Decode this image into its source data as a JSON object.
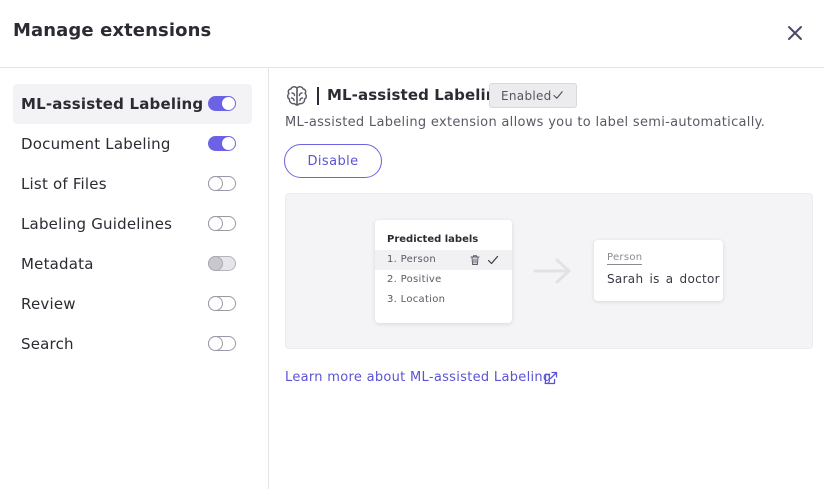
{
  "header": {
    "title": "Manage extensions",
    "close_icon": "close-icon"
  },
  "sidebar": {
    "items": [
      {
        "label": "ML-assisted Labeling",
        "enabled": true,
        "active": true
      },
      {
        "label": "Document Labeling",
        "enabled": true,
        "active": false
      },
      {
        "label": "List of Files",
        "enabled": false,
        "active": false
      },
      {
        "label": "Labeling Guidelines",
        "enabled": false,
        "active": false
      },
      {
        "label": "Metadata",
        "enabled": false,
        "active": false,
        "disabled": true
      },
      {
        "label": "Review",
        "enabled": false,
        "active": false
      },
      {
        "label": "Search",
        "enabled": false,
        "active": false
      }
    ]
  },
  "main": {
    "icon": "brain-icon",
    "title": "ML-assisted Labeling",
    "badge": "Enabled",
    "description": "ML-assisted Labeling extension allows you to label semi-automatically.",
    "disable_label": "Disable",
    "preview": {
      "predicted_title": "Predicted labels",
      "predictions": [
        "1.  Person",
        "2.  Positive",
        "3.  Location"
      ],
      "result_label": "Person",
      "result_text": "Sarah is a doctor"
    },
    "learn_more": "Learn more about ML-assisted Labeling"
  },
  "colors": {
    "accent": "#6b63e4",
    "link": "#5b53d6",
    "active_bg": "#f3f3f5",
    "preview_bg": "#f4f4f6"
  }
}
